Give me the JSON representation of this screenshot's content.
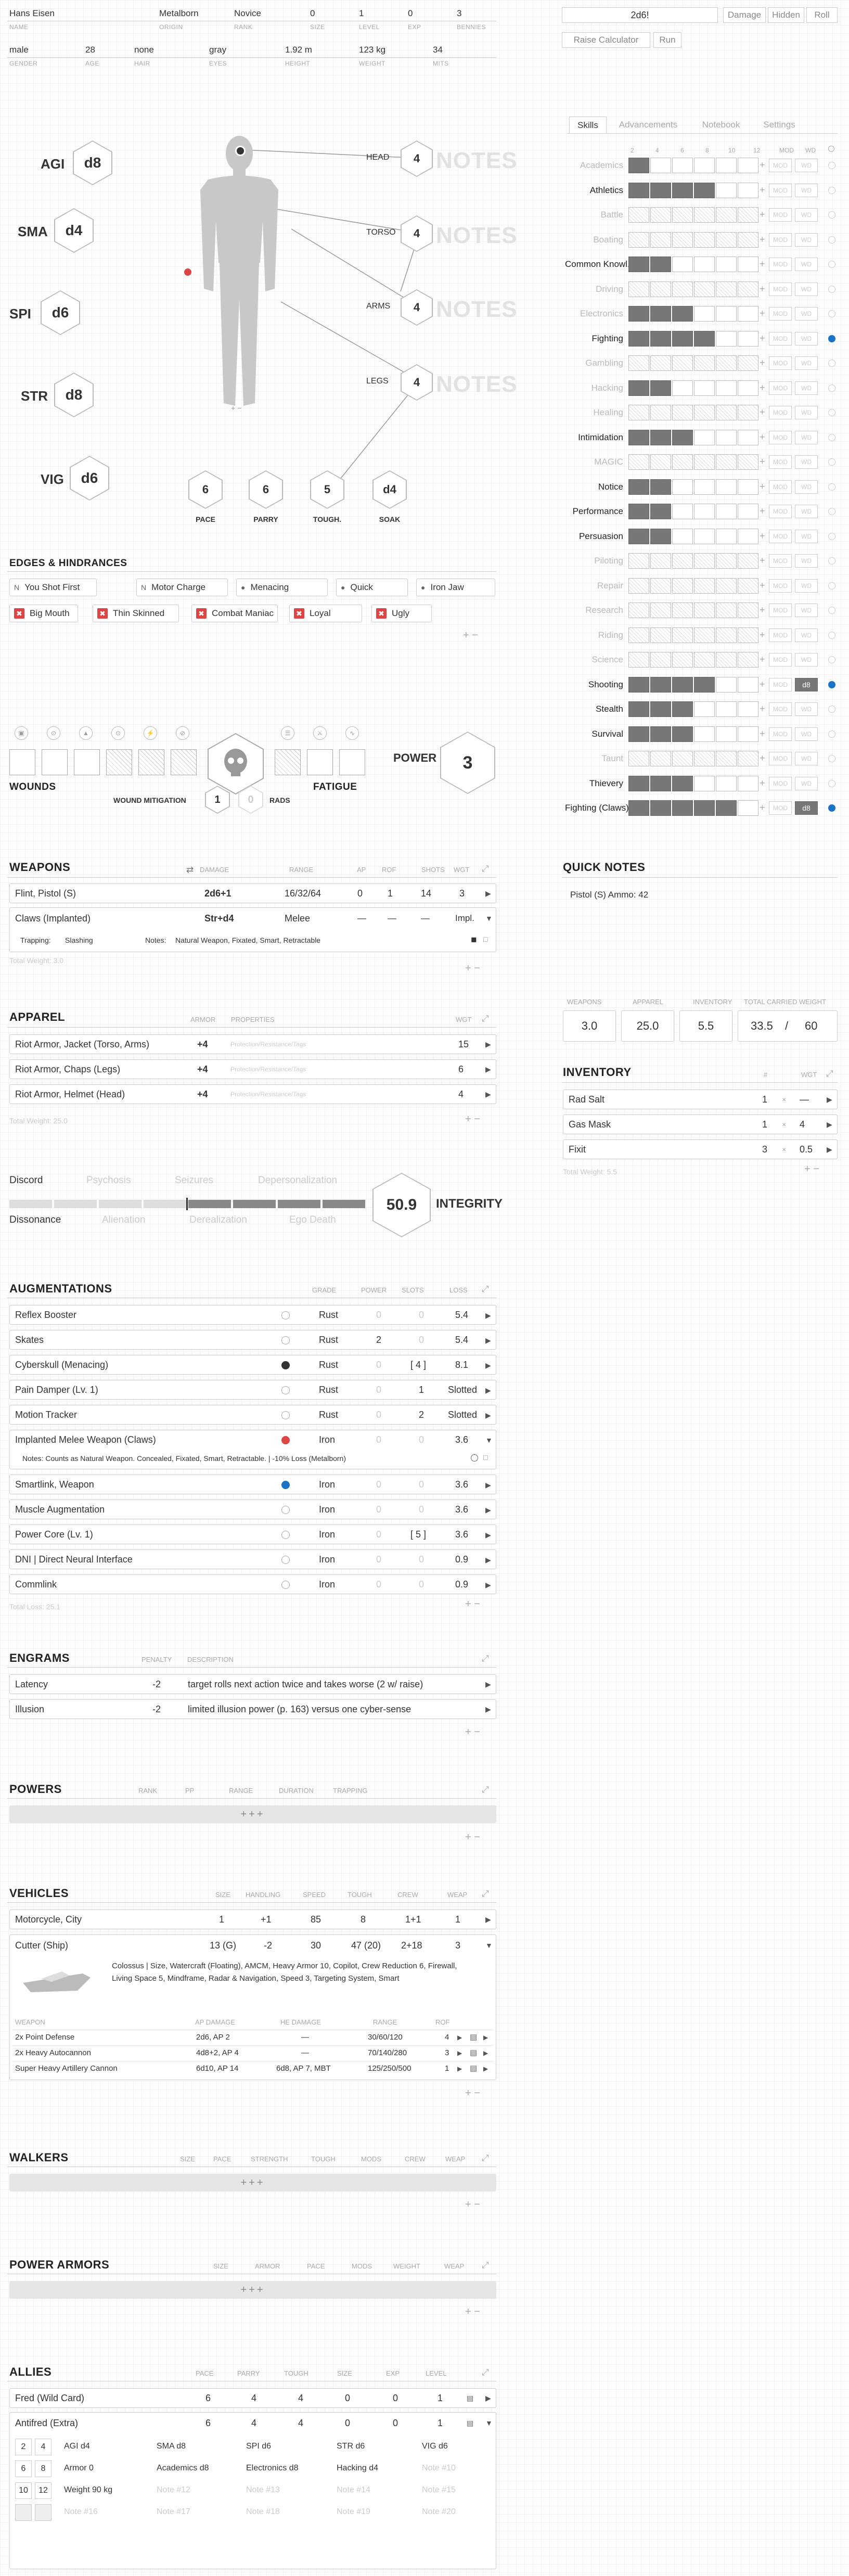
{
  "header": {
    "name": "Hans Eisen",
    "origin": "Metalborn",
    "rank": "Novice",
    "size": "0",
    "level": "1",
    "exp": "0",
    "bennies": "3",
    "gender": "male",
    "age": "28",
    "hair": "none",
    "eyes": "gray",
    "height": "1.92 m",
    "weight": "123 kg",
    "mits": "34",
    "labels": {
      "name": "NAME",
      "origin": "ORIGIN",
      "rank": "RANK",
      "size": "SIZE",
      "level": "LEVEL",
      "exp": "EXP",
      "bennies": "BENNIES",
      "gender": "GENDER",
      "age": "AGE",
      "hair": "HAIR",
      "eyes": "EYES",
      "height": "HEIGHT",
      "weight": "WEIGHT",
      "mits": "MITS"
    }
  },
  "roller": {
    "expr": "2d6!",
    "damage": "Damage",
    "hidden": "Hidden",
    "roll": "Roll",
    "raise_calc": "Raise Calculator",
    "run": "Run"
  },
  "attributes": [
    {
      "name": "AGI",
      "die": "d8"
    },
    {
      "name": "SMA",
      "die": "d4"
    },
    {
      "name": "SPI",
      "die": "d6"
    },
    {
      "name": "STR",
      "die": "d8"
    },
    {
      "name": "VIG",
      "die": "d6"
    }
  ],
  "body_armor": [
    {
      "part": "HEAD",
      "value": "4",
      "notes": "NOTES"
    },
    {
      "part": "TORSO",
      "value": "4",
      "notes": "NOTES"
    },
    {
      "part": "ARMS",
      "value": "4",
      "notes": "NOTES"
    },
    {
      "part": "LEGS",
      "value": "4",
      "notes": "NOTES"
    }
  ],
  "body_plusminus": "+ −",
  "derived": [
    {
      "name": "PACE",
      "value": "6"
    },
    {
      "name": "PARRY",
      "value": "6"
    },
    {
      "name": "TOUGH.",
      "value": "5"
    },
    {
      "name": "SOAK",
      "value": "d4"
    }
  ],
  "tabs": [
    "Skills",
    "Advancements",
    "Notebook",
    "Settings"
  ],
  "skill_cols": [
    "2",
    "4",
    "6",
    "8",
    "10",
    "12",
    "MOD",
    "WD"
  ],
  "skills": [
    {
      "name": "Academics",
      "level": 1,
      "bold": false,
      "mod": "MOD",
      "wd": "WD",
      "dot": false
    },
    {
      "name": "Athletics",
      "level": 4,
      "bold": true,
      "mod": "MOD",
      "wd": "WD",
      "dot": false
    },
    {
      "name": "Battle",
      "level": 0,
      "bold": false,
      "mod": "MOD",
      "wd": "WD",
      "dot": false
    },
    {
      "name": "Boating",
      "level": 0,
      "bold": false,
      "mod": "MOD",
      "wd": "WD",
      "dot": false
    },
    {
      "name": "Common Knowl.",
      "level": 2,
      "bold": true,
      "mod": "MOD",
      "wd": "WD",
      "dot": false
    },
    {
      "name": "Driving",
      "level": 0,
      "bold": false,
      "mod": "MOD",
      "wd": "WD",
      "dot": false
    },
    {
      "name": "Electronics",
      "level": 3,
      "bold": false,
      "mod": "MOD",
      "wd": "WD",
      "dot": false
    },
    {
      "name": "Fighting",
      "level": 4,
      "bold": true,
      "mod": "MOD",
      "wd": "WD",
      "dot": true
    },
    {
      "name": "Gambling",
      "level": 0,
      "bold": false,
      "mod": "MOD",
      "wd": "WD",
      "dot": false
    },
    {
      "name": "Hacking",
      "level": 2,
      "bold": false,
      "mod": "MOD",
      "wd": "WD",
      "dot": false
    },
    {
      "name": "Healing",
      "level": 0,
      "bold": false,
      "mod": "MOD",
      "wd": "WD",
      "dot": false
    },
    {
      "name": "Intimidation",
      "level": 3,
      "bold": true,
      "mod": "MOD",
      "wd": "WD",
      "dot": false
    },
    {
      "name": "MAGIC",
      "level": 0,
      "bold": false,
      "mod": "MOD",
      "wd": "WD",
      "dot": false
    },
    {
      "name": "Notice",
      "level": 2,
      "bold": true,
      "mod": "MOD",
      "wd": "WD",
      "dot": false
    },
    {
      "name": "Performance",
      "level": 2,
      "bold": true,
      "mod": "MOD",
      "wd": "WD",
      "dot": false
    },
    {
      "name": "Persuasion",
      "level": 2,
      "bold": true,
      "mod": "MOD",
      "wd": "WD",
      "dot": false
    },
    {
      "name": "Piloting",
      "level": 0,
      "bold": false,
      "mod": "MOD",
      "wd": "WD",
      "dot": false
    },
    {
      "name": "Repair",
      "level": 0,
      "bold": false,
      "mod": "MOD",
      "wd": "WD",
      "dot": false
    },
    {
      "name": "Research",
      "level": 0,
      "bold": false,
      "mod": "MOD",
      "wd": "WD",
      "dot": false
    },
    {
      "name": "Riding",
      "level": 0,
      "bold": false,
      "mod": "MOD",
      "wd": "WD",
      "dot": false
    },
    {
      "name": "Science",
      "level": 0,
      "bold": false,
      "mod": "MOD",
      "wd": "WD",
      "dot": false
    },
    {
      "name": "Shooting",
      "level": 4,
      "bold": true,
      "mod": "MOD",
      "wd": "d8",
      "dot": true
    },
    {
      "name": "Stealth",
      "level": 3,
      "bold": true,
      "mod": "MOD",
      "wd": "WD",
      "dot": false
    },
    {
      "name": "Survival",
      "level": 3,
      "bold": true,
      "mod": "MOD",
      "wd": "WD",
      "dot": false
    },
    {
      "name": "Taunt",
      "level": 0,
      "bold": false,
      "mod": "MOD",
      "wd": "WD",
      "dot": false
    },
    {
      "name": "Thievery",
      "level": 3,
      "bold": true,
      "mod": "MOD",
      "wd": "WD",
      "dot": false
    },
    {
      "name": "Fighting (Claws)",
      "level": 5,
      "bold": true,
      "mod": "MOD",
      "wd": "d8",
      "dot": true
    }
  ],
  "edges": {
    "title": "EDGES & HINDRANCES",
    "row1": [
      {
        "tag": "N",
        "label": "You Shot First"
      },
      {
        "tag": "N",
        "label": "Motor Charge"
      },
      {
        "tag": "●",
        "label": "Menacing"
      },
      {
        "tag": "●",
        "label": "Quick"
      },
      {
        "tag": "●",
        "label": "Iron Jaw"
      }
    ],
    "row2": [
      "Big Mouth",
      "Thin Skinned",
      "Combat Maniac",
      "Loyal",
      "Ugly"
    ]
  },
  "wounds": {
    "label": "WOUNDS",
    "fatigue": "FATIGUE",
    "mitigation_label": "WOUND MITIGATION",
    "mitigation": "1",
    "rads_value": "0",
    "rads": "RADS",
    "power_label": "POWER",
    "power": "3"
  },
  "weapons": {
    "title": "WEAPONS",
    "cols": [
      "DAMAGE",
      "RANGE",
      "AP",
      "ROF",
      "SHOTS",
      "WGT"
    ],
    "rows": [
      {
        "name": "Flint, Pistol (S)",
        "damage": "2d6+1",
        "range": "16/32/64",
        "ap": "0",
        "rof": "1",
        "shots": "14",
        "wgt": "3"
      },
      {
        "name": "Claws (Implanted)",
        "damage": "Str+d4",
        "range": "Melee",
        "ap": "—",
        "rof": "—",
        "shots": "—",
        "wgt": "Impl."
      }
    ],
    "trapping_label": "Trapping:",
    "trapping": "Slashing",
    "notes_label": "Notes:",
    "notes": "Natural Weapon, Fixated, Smart, Retractable",
    "total": "Total Weight: 3.0"
  },
  "quick_notes": {
    "title": "QUICK NOTES",
    "text": "Pistol (S) Ammo: 42"
  },
  "apparel": {
    "title": "APPAREL",
    "cols": [
      "ARMOR",
      "PROPERTIES",
      "WGT"
    ],
    "placeholder": "Protection/Resistance/Tags",
    "rows": [
      {
        "name": "Riot Armor, Jacket (Torso, Arms)",
        "armor": "+4",
        "wgt": "15"
      },
      {
        "name": "Riot Armor, Chaps (Legs)",
        "armor": "+4",
        "wgt": "6"
      },
      {
        "name": "Riot Armor, Helmet (Head)",
        "armor": "+4",
        "wgt": "4"
      }
    ],
    "total": "Total Weight: 25.0"
  },
  "weights": {
    "labels": [
      "WEAPONS",
      "APPAREL",
      "INVENTORY",
      "TOTAL CARRIED WEIGHT"
    ],
    "weapons": "3.0",
    "apparel": "25.0",
    "inventory": "5.5",
    "total": "33.5",
    "sep": "/",
    "max": "60"
  },
  "inventory": {
    "title": "INVENTORY",
    "cols": [
      "#",
      "WGT"
    ],
    "rows": [
      {
        "name": "Rad Salt",
        "qty": "1",
        "wgt": "—"
      },
      {
        "name": "Gas Mask",
        "qty": "1",
        "wgt": "4"
      },
      {
        "name": "Fixit",
        "qty": "3",
        "wgt": "0.5"
      }
    ],
    "total": "Total Weight: 5.5"
  },
  "integrity": {
    "top": [
      "Discord",
      "Psychosis",
      "Seizures",
      "Depersonalization"
    ],
    "bottom": [
      "Dissonance",
      "Alienation",
      "Derealization",
      "Ego Death"
    ],
    "value": "50.9",
    "label": "INTEGRITY",
    "fill": 0.49
  },
  "augmentations": {
    "title": "AUGMENTATIONS",
    "cols": [
      "GRADE",
      "POWER",
      "SLOTS",
      "LOSS"
    ],
    "rows": [
      {
        "name": "Reflex Booster",
        "grade": "Rust",
        "power": "0",
        "slots": "0",
        "loss": "5.4",
        "dot": "none"
      },
      {
        "name": "Skates",
        "grade": "Rust",
        "power": "2",
        "slots": "0",
        "loss": "5.4",
        "dot": "none"
      },
      {
        "name": "Cyberskull (Menacing)",
        "grade": "Rust",
        "power": "0",
        "slots": "[ 4 ]",
        "loss": "8.1",
        "dot": "black"
      },
      {
        "name": "Pain Damper (Lv. 1)",
        "grade": "Rust",
        "power": "0",
        "slots": "1",
        "loss": "Slotted",
        "dot": "none"
      },
      {
        "name": "Motion Tracker",
        "grade": "Rust",
        "power": "0",
        "slots": "2",
        "loss": "Slotted",
        "dot": "none"
      },
      {
        "name": "Implanted Melee Weapon (Claws)",
        "grade": "Iron",
        "power": "0",
        "slots": "0",
        "loss": "3.6",
        "dot": "red"
      },
      {
        "name": "Smartlink, Weapon",
        "grade": "Iron",
        "power": "0",
        "slots": "0",
        "loss": "3.6",
        "dot": "blue"
      },
      {
        "name": "Muscle Augmentation",
        "grade": "Iron",
        "power": "0",
        "slots": "0",
        "loss": "3.6",
        "dot": "none"
      },
      {
        "name": "Power Core (Lv. 1)",
        "grade": "Iron",
        "power": "0",
        "slots": "[ 5 ]",
        "loss": "3.6",
        "dot": "none"
      },
      {
        "name": "DNI | Direct Neural Interface",
        "grade": "Iron",
        "power": "0",
        "slots": "0",
        "loss": "0.9",
        "dot": "none"
      },
      {
        "name": "Commlink",
        "grade": "Iron",
        "power": "0",
        "slots": "0",
        "loss": "0.9",
        "dot": "none"
      }
    ],
    "notes": "Notes:  Counts as Natural Weapon. Concealed, Fixated, Smart, Retractable. | -10% Loss (Metalborn)",
    "total": "Total Loss: 25.1"
  },
  "engrams": {
    "title": "ENGRAMS",
    "cols": [
      "PENALTY",
      "DESCRIPTION"
    ],
    "rows": [
      {
        "name": "Latency",
        "penalty": "-2",
        "desc": "target rolls next action twice and takes worse (2 w/ raise)"
      },
      {
        "name": "Illusion",
        "penalty": "-2",
        "desc": "limited illusion power (p. 163) versus one cyber-sense"
      }
    ]
  },
  "powers": {
    "title": "POWERS",
    "cols": [
      "RANK",
      "PP",
      "RANGE",
      "DURATION",
      "TRAPPING"
    ],
    "add": "+++"
  },
  "vehicles": {
    "title": "VEHICLES",
    "cols": [
      "SIZE",
      "HANDLING",
      "SPEED",
      "TOUGH",
      "CREW",
      "WEAP"
    ],
    "rows": [
      {
        "name": "Motorcycle, City",
        "size": "1",
        "handling": "+1",
        "speed": "85",
        "tough": "8",
        "crew": "1+1",
        "weap": "1"
      },
      {
        "name": "Cutter (Ship)",
        "size": "13 (G)",
        "handling": "-2",
        "speed": "30",
        "tough": "47 (20)",
        "crew": "2+18",
        "weap": "3"
      }
    ],
    "desc": "Colossus | Size, Watercraft (Floating), AMCM, Heavy Armor 10, Copilot, Crew Reduction 6, Firewall, Living Space 5, Mindframe, Radar & Navigation, Speed 3, Targeting System, Smart",
    "weap_cols": [
      "WEAPON",
      "AP DAMAGE",
      "HE DAMAGE",
      "RANGE",
      "ROF"
    ],
    "weapons": [
      {
        "name": "2x Point Defense",
        "ap": "2d6, AP 2",
        "he": "—",
        "range": "30/60/120",
        "rof": "4"
      },
      {
        "name": "2x Heavy Autocannon",
        "ap": "4d8+2, AP 4",
        "he": "—",
        "range": "70/140/280",
        "rof": "3"
      },
      {
        "name": "Super Heavy Artillery Cannon",
        "ap": "6d10, AP 14",
        "he": "6d8, AP 7, MBT",
        "range": "125/250/500",
        "rof": "1"
      }
    ]
  },
  "walkers": {
    "title": "WALKERS",
    "cols": [
      "SIZE",
      "PACE",
      "STRENGTH",
      "TOUGH",
      "MODS",
      "CREW",
      "WEAP"
    ],
    "add": "+++"
  },
  "power_armors": {
    "title": "POWER ARMORS",
    "cols": [
      "SIZE",
      "ARMOR",
      "PACE",
      "MODS",
      "WEIGHT",
      "WEAP"
    ],
    "add": "+++"
  },
  "allies": {
    "title": "ALLIES",
    "cols": [
      "PACE",
      "PARRY",
      "TOUGH",
      "SIZE",
      "EXP",
      "LEVEL"
    ],
    "rows": [
      {
        "name": "Fred (Wild Card)",
        "pace": "6",
        "parry": "4",
        "tough": "4",
        "size": "0",
        "exp": "0",
        "level": "1"
      },
      {
        "name": "Antifred (Extra)",
        "pace": "6",
        "parry": "4",
        "tough": "4",
        "size": "0",
        "exp": "0",
        "level": "1"
      }
    ],
    "detail_nums": [
      "2",
      "4",
      "6",
      "8",
      "10",
      "12"
    ],
    "detail": [
      [
        "AGI d4",
        "SMA d8",
        "SPI d6",
        "STR d6",
        "VIG d6"
      ],
      [
        "Armor 0",
        "Academics d8",
        "Electronics d8",
        "Hacking d4",
        "Note #10"
      ],
      [
        "Weight 90 kg",
        "Note #12",
        "Note #13",
        "Note #14",
        "Note #15"
      ],
      [
        "Note #16",
        "Note #17",
        "Note #18",
        "Note #19",
        "Note #20"
      ]
    ]
  }
}
